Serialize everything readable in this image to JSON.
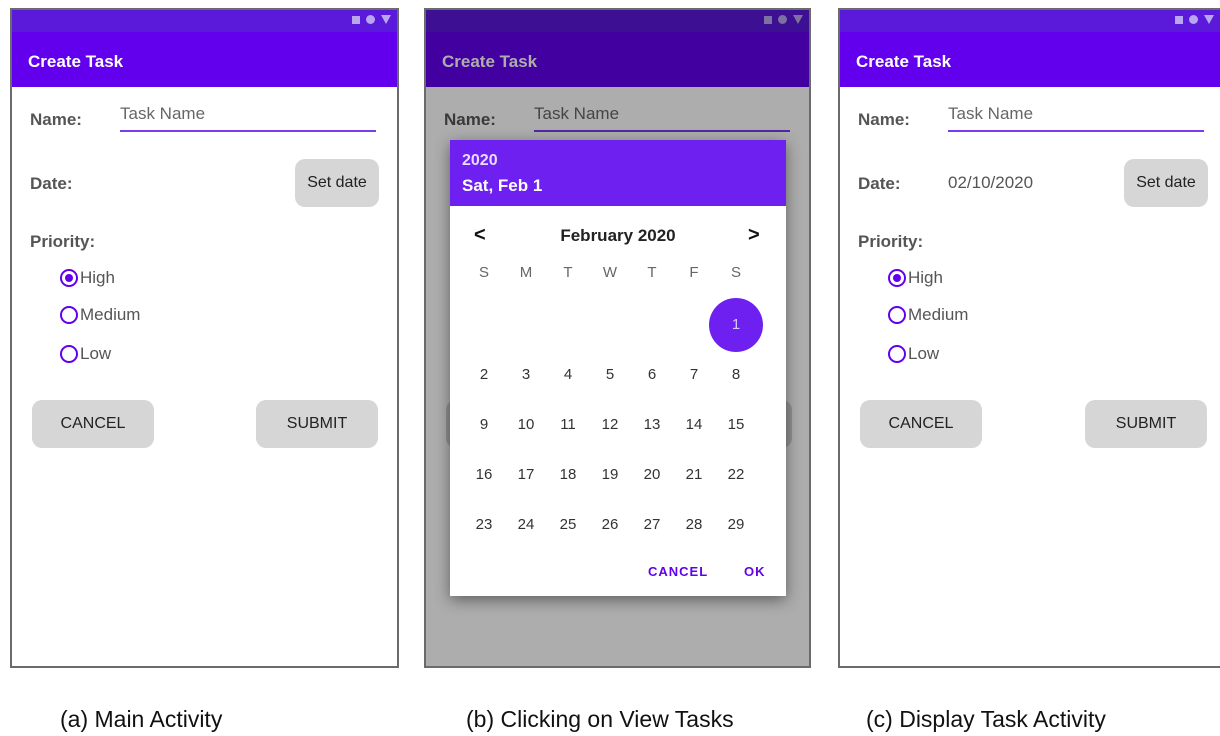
{
  "app_title": "Create Task",
  "form": {
    "name_label": "Name:",
    "name_placeholder": "Task Name",
    "date_label": "Date:",
    "set_date_label": "Set date",
    "priority_label": "Priority:",
    "priority_options": [
      "High",
      "Medium",
      "Low"
    ],
    "selected_priority": "High",
    "cancel_label": "CANCEL",
    "submit_label": "SUBMIT"
  },
  "screen_c": {
    "date_value": "02/10/2020"
  },
  "date_picker": {
    "year": "2020",
    "selected_date": "Sat, Feb 1",
    "month_title": "February 2020",
    "prev": "<",
    "next": ">",
    "weekdays": [
      "S",
      "M",
      "T",
      "W",
      "T",
      "F",
      "S"
    ],
    "weeks": [
      [
        "",
        "",
        "",
        "",
        "",
        "",
        "1"
      ],
      [
        "2",
        "3",
        "4",
        "5",
        "6",
        "7",
        "8"
      ],
      [
        "9",
        "10",
        "11",
        "12",
        "13",
        "14",
        "15"
      ],
      [
        "16",
        "17",
        "18",
        "19",
        "20",
        "21",
        "22"
      ],
      [
        "23",
        "24",
        "25",
        "26",
        "27",
        "28",
        "29"
      ]
    ],
    "selected_day": "1",
    "cancel": "CANCEL",
    "ok": "OK"
  },
  "captions": [
    "(a) Main Activity",
    "(b) Clicking on View Tasks",
    "(c) Display Task Activity"
  ],
  "colors": {
    "primary": "#6200ee",
    "status_bar": "#5b19d9",
    "button_bg": "#d6d6d6"
  }
}
